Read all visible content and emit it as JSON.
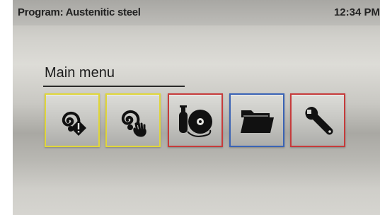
{
  "status_bar": {
    "program": "Program: Austenitic steel",
    "time": "12:34 PM"
  },
  "main_menu": {
    "heading": "Main menu",
    "buttons": [
      {
        "icon": "weld-spiral-warning-icon",
        "border_color": "#e0d63a"
      },
      {
        "icon": "weld-spiral-manual-icon",
        "border_color": "#e0d63a"
      },
      {
        "icon": "gas-bottle-wire-reel-icon",
        "border_color": "#c63b3b"
      },
      {
        "icon": "folder-icon",
        "border_color": "#3a63b5"
      },
      {
        "icon": "wrench-icon",
        "border_color": "#c63b3b"
      }
    ]
  }
}
